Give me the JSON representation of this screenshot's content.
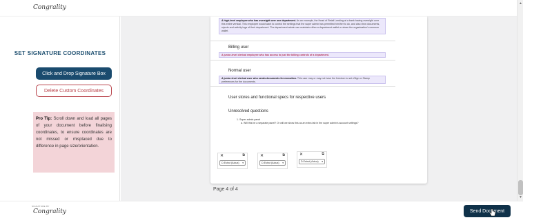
{
  "header": {
    "logo_text": "Congrality"
  },
  "sidebar": {
    "title": "SET SIGNATURE COORDINATES",
    "click_drop_label": "Click and Drop Signature Box",
    "delete_label": "Delete Custom Coordinates",
    "tip_label": "Pro Tip:",
    "tip_text": "Scroll down and load all pages of your document before finalising coordinates, to ensure coordinates are not missed or misplaced due to difference in page size/orientation."
  },
  "document": {
    "callout_top_bold": "A high-level employee who has oversight over one department.",
    "callout_top_rest": "As an example, the Head of Retail Lending at a bank having oversight over this entire vertical. This employee would want to control the settings that the super admin has permitted him/her to do, and also view documents, rejects and activity logs of their department. The department admin can maintain either a department wallet or share the organisation's common wallet.",
    "billing_heading": "Billing user",
    "billing_callout": "A junior-level clerical employee who has access to just the billing controls of a department.",
    "normal_heading": "Normal user",
    "normal_callout_bold": "A junior-level clerical user who sends documents for execution.",
    "normal_callout_rest": "This user may or may not have the freedom to set eSign or Stamp preferences for the documents.",
    "stories_heading": "User stores and functional specs for respective users",
    "unresolved_heading": "Unresolved questions",
    "list_item": "1.   Super admin panel",
    "list_sub": "a.   Will this be a separate panel? Or will we show this as an extra tab in the super admin's account settings?"
  },
  "signature_boxes": [
    {
      "close": "✕",
      "copy": "⧉",
      "select_value": "D.Estrut (Actua)"
    },
    {
      "close": "✕",
      "copy": "⧉",
      "select_value": "D.Estrut (Actua)"
    },
    {
      "close": "✕",
      "copy": "⧉",
      "select_value": "D.Estrut (Actua)"
    }
  ],
  "page_info": "Page 4 of 4",
  "footer": {
    "logo_small": "SIGNATURE BY",
    "logo_text": "Congrality",
    "send_label": "Send Document"
  },
  "colors": {
    "primary": "#1a4b6e",
    "danger": "#b8424a",
    "send": "#0f3149",
    "tip_bg": "#f3d4d8",
    "callout_bg": "#ece8fb"
  }
}
